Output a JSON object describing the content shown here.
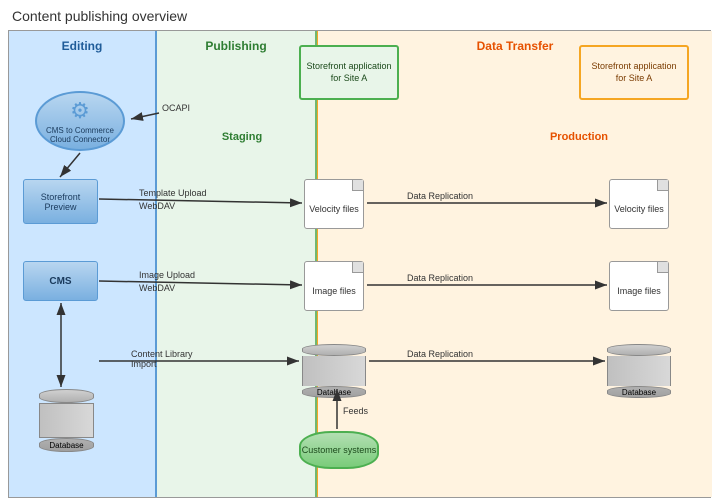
{
  "title": "Content publishing overview",
  "sections": {
    "editing": {
      "label": "Editing"
    },
    "publishing": {
      "label": "Publishing"
    },
    "datatransfer": {
      "label": "Data Transfer"
    }
  },
  "boxes": {
    "connector": {
      "label": "CMS to Commerce Cloud Connector"
    },
    "storefrontPreview": {
      "label": "Storefront Preview"
    },
    "cms": {
      "label": "CMS"
    },
    "databaseLeft": {
      "label": "Database"
    },
    "storefrontSiteA": {
      "label": "Storefront application for Site A"
    },
    "staging": {
      "label": "Staging"
    },
    "velocityFilesStaging": {
      "label": "Velocity files"
    },
    "imageFilesStaging": {
      "label": "Image files"
    },
    "databaseStaging": {
      "label": "Database"
    },
    "customerSystems": {
      "label": "Customer systems"
    },
    "storefrontSiteAProd": {
      "label": "Storefront application for Site A"
    },
    "production": {
      "label": "Production"
    },
    "velocityFilesProd": {
      "label": "Velocity files"
    },
    "imageFilesProd": {
      "label": "Image files"
    },
    "databaseProd": {
      "label": "Database"
    }
  },
  "arrows": {
    "ocapi": "OCAPI",
    "templateUpload": "Template Upload WebDAV",
    "imageUpload": "Image Upload WebDAV",
    "contentLibrary": "Content Library Import",
    "dataReplication1": "Data Replication",
    "dataReplication2": "Data Replication",
    "dataReplication3": "Data Replication",
    "feeds": "Feeds"
  }
}
